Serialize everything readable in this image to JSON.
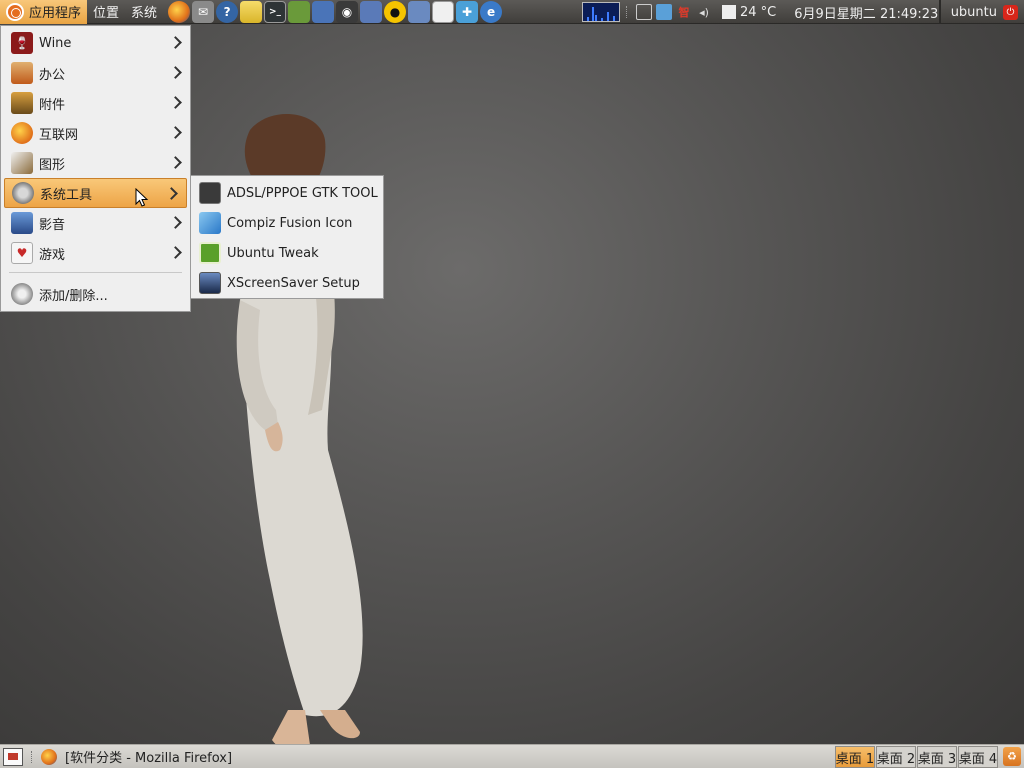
{
  "top_panel": {
    "menus": [
      {
        "label": "应用程序",
        "active": true
      },
      {
        "label": "位置",
        "active": false
      },
      {
        "label": "系统",
        "active": false
      }
    ],
    "launchers": [
      {
        "icon": "firefox-icon",
        "color": "#e0701a"
      },
      {
        "icon": "mail-icon",
        "color": "#7a7a7a"
      },
      {
        "icon": "help-icon",
        "color": "#3465a4"
      },
      {
        "icon": "folder-icon",
        "color": "#e9c63a"
      },
      {
        "icon": "terminal-icon",
        "color": "#2e3436"
      },
      {
        "icon": "book-icon",
        "color": "#6a9a3a"
      },
      {
        "icon": "image-viewer-icon",
        "color": "#4a74b8"
      },
      {
        "icon": "webcam-icon",
        "color": "#3a3a3a"
      },
      {
        "icon": "screenshot-icon",
        "color": "#5a7ab8"
      },
      {
        "icon": "qq-icon",
        "color": "#1a1a1a"
      },
      {
        "icon": "users-icon",
        "color": "#6a8ac0"
      },
      {
        "icon": "text-editor-icon",
        "color": "#f0f0f0"
      },
      {
        "icon": "compiz-icon",
        "color": "#4aa0d8"
      },
      {
        "icon": "browser-icon",
        "color": "#3a7ac8"
      }
    ],
    "tray": {
      "temperature": "24 °C",
      "datetime": "6月9日星期二 21:49:23",
      "ime_label": "智"
    },
    "user": "ubuntu"
  },
  "main_menu": {
    "items": [
      {
        "label": "Wine",
        "icon": "wine-icon",
        "color": "#8b1a1a",
        "submenu": true
      },
      {
        "label": "办公",
        "icon": "office-icon",
        "color": "#c05a1a",
        "submenu": true
      },
      {
        "label": "附件",
        "icon": "accessories-icon",
        "color": "#b0761a",
        "submenu": true
      },
      {
        "label": "互联网",
        "icon": "internet-icon",
        "color": "#e0701a",
        "submenu": true
      },
      {
        "label": "图形",
        "icon": "graphics-icon",
        "color": "#8a6a3a",
        "submenu": true
      },
      {
        "label": "系统工具",
        "icon": "system-tools-icon",
        "color": "#7a7a7a",
        "submenu": true
      },
      {
        "label": "影音",
        "icon": "multimedia-icon",
        "color": "#3a6aa8",
        "submenu": true
      },
      {
        "label": "游戏",
        "icon": "games-icon",
        "color": "#c82a2a",
        "submenu": true
      }
    ],
    "add_remove": {
      "label": "添加/删除...",
      "icon": "add-remove-icon",
      "color": "#7a7a7a"
    }
  },
  "system_tools_submenu": {
    "items": [
      {
        "label": "ADSL/PPPOE GTK TOOL",
        "icon": "network-tool-icon",
        "color": "#3a3a3a"
      },
      {
        "label": "Compiz Fusion Icon",
        "icon": "compiz-fusion-icon",
        "color": "#2a78c8"
      },
      {
        "label": "Ubuntu Tweak",
        "icon": "ubuntu-tweak-icon",
        "color": "#5aa02a"
      },
      {
        "label": "XScreenSaver Setup",
        "icon": "screensaver-icon",
        "color": "#3a4a6a"
      }
    ]
  },
  "bottom_panel": {
    "task_title": "[软件分类 - Mozilla Firefox]",
    "workspaces": [
      {
        "label": "桌面 1",
        "active": true
      },
      {
        "label": "桌面 2",
        "active": false
      },
      {
        "label": "桌面 3",
        "active": false
      },
      {
        "label": "桌面 4",
        "active": false
      }
    ]
  },
  "colors": {
    "highlight": "#eda446",
    "panel_dark": "#403e3b",
    "menu_bg": "#efefef"
  }
}
